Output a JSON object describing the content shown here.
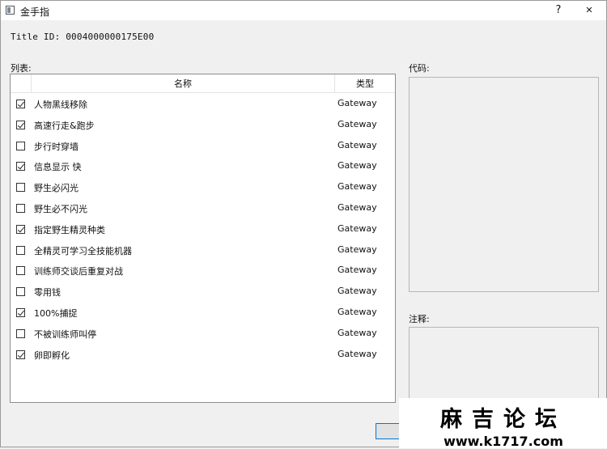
{
  "window": {
    "title": "金手指",
    "help_label": "?",
    "close_label": "✕"
  },
  "title_id": "Title ID: 0004000000175E00",
  "list": {
    "label": "列表:",
    "headers": {
      "name": "名称",
      "type": "类型"
    },
    "items": [
      {
        "name": "人物黑线移除",
        "type": "Gateway",
        "checked": true
      },
      {
        "name": "高速行走&跑步",
        "type": "Gateway",
        "checked": true
      },
      {
        "name": "步行时穿墙",
        "type": "Gateway",
        "checked": false
      },
      {
        "name": "信息显示  快",
        "type": "Gateway",
        "checked": true
      },
      {
        "name": "野生必闪光",
        "type": "Gateway",
        "checked": false
      },
      {
        "name": "野生必不闪光",
        "type": "Gateway",
        "checked": false
      },
      {
        "name": "指定野生精灵种类",
        "type": "Gateway",
        "checked": true
      },
      {
        "name": "全精灵可学习全技能机器",
        "type": "Gateway",
        "checked": false
      },
      {
        "name": "训练师交谈后重复对战",
        "type": "Gateway",
        "checked": false
      },
      {
        "name": "零用钱",
        "type": "Gateway",
        "checked": false
      },
      {
        "name": "100%捕捉",
        "type": "Gateway",
        "checked": true
      },
      {
        "name": "不被训练师叫停",
        "type": "Gateway",
        "checked": false
      },
      {
        "name": "卵即孵化",
        "type": "Gateway",
        "checked": true
      }
    ]
  },
  "code": {
    "label": "代码:",
    "value": ""
  },
  "notes": {
    "label": "注释:",
    "value": ""
  },
  "watermark": {
    "title": "麻吉论坛",
    "url": "www.k1717.com"
  }
}
